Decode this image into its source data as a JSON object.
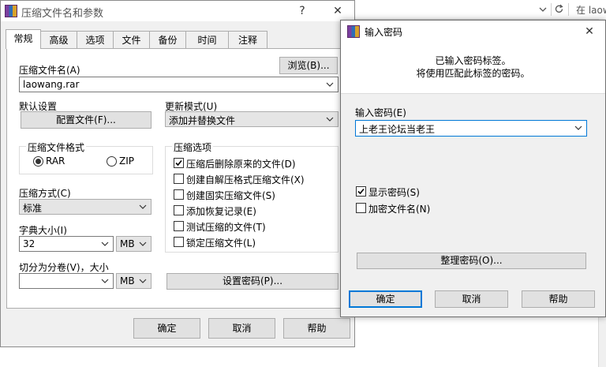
{
  "browser": {
    "address_text": "在 laow"
  },
  "main_dialog": {
    "title": "压缩文件名和参数",
    "help_glyph": "?",
    "close_glyph": "✕",
    "tabs": [
      {
        "label": "常规",
        "active": true
      },
      {
        "label": "高级"
      },
      {
        "label": "选项"
      },
      {
        "label": "文件"
      },
      {
        "label": "备份"
      },
      {
        "label": "时间"
      },
      {
        "label": "注释"
      }
    ],
    "archive_name_label": "压缩文件名(A)",
    "browse_button": "浏览(B)...",
    "archive_name_value": "laowang.rar",
    "default_settings_label": "默认设置",
    "profile_button": "配置文件(F)...",
    "update_mode_label": "更新模式(U)",
    "update_mode_value": "添加并替换文件",
    "format_group_title": "压缩文件格式",
    "format_rar": "RAR",
    "format_zip": "ZIP",
    "options_group_title": "压缩选项",
    "options": [
      {
        "label": "压缩后删除原来的文件(D)",
        "checked": true
      },
      {
        "label": "创建自解压格式压缩文件(X)",
        "checked": false
      },
      {
        "label": "创建固实压缩文件(S)",
        "checked": false
      },
      {
        "label": "添加恢复记录(E)",
        "checked": false
      },
      {
        "label": "测试压缩的文件(T)",
        "checked": false
      },
      {
        "label": "锁定压缩文件(L)",
        "checked": false
      }
    ],
    "method_label": "压缩方式(C)",
    "method_value": "标准",
    "dict_label": "字典大小(I)",
    "dict_value": "32",
    "dict_unit": "MB",
    "split_label": "切分为分卷(V)，大小",
    "split_value": "",
    "split_unit": "MB",
    "set_password_button": "设置密码(P)...",
    "ok_button": "确定",
    "cancel_button": "取消",
    "help_button": "帮助"
  },
  "password_dialog": {
    "title": "输入密码",
    "close_glyph": "✕",
    "info_line1": "已输入密码标签。",
    "info_line2": "将使用匹配此标签的密码。",
    "password_label": "输入密码(E)",
    "password_value": "上老王论坛当老王",
    "show_password": {
      "label": "显示密码(S)",
      "checked": true
    },
    "encrypt_names": {
      "label": "加密文件名(N)",
      "checked": false
    },
    "organize_button": "整理密码(O)...",
    "ok_button": "确定",
    "cancel_button": "取消",
    "help_button": "帮助"
  }
}
